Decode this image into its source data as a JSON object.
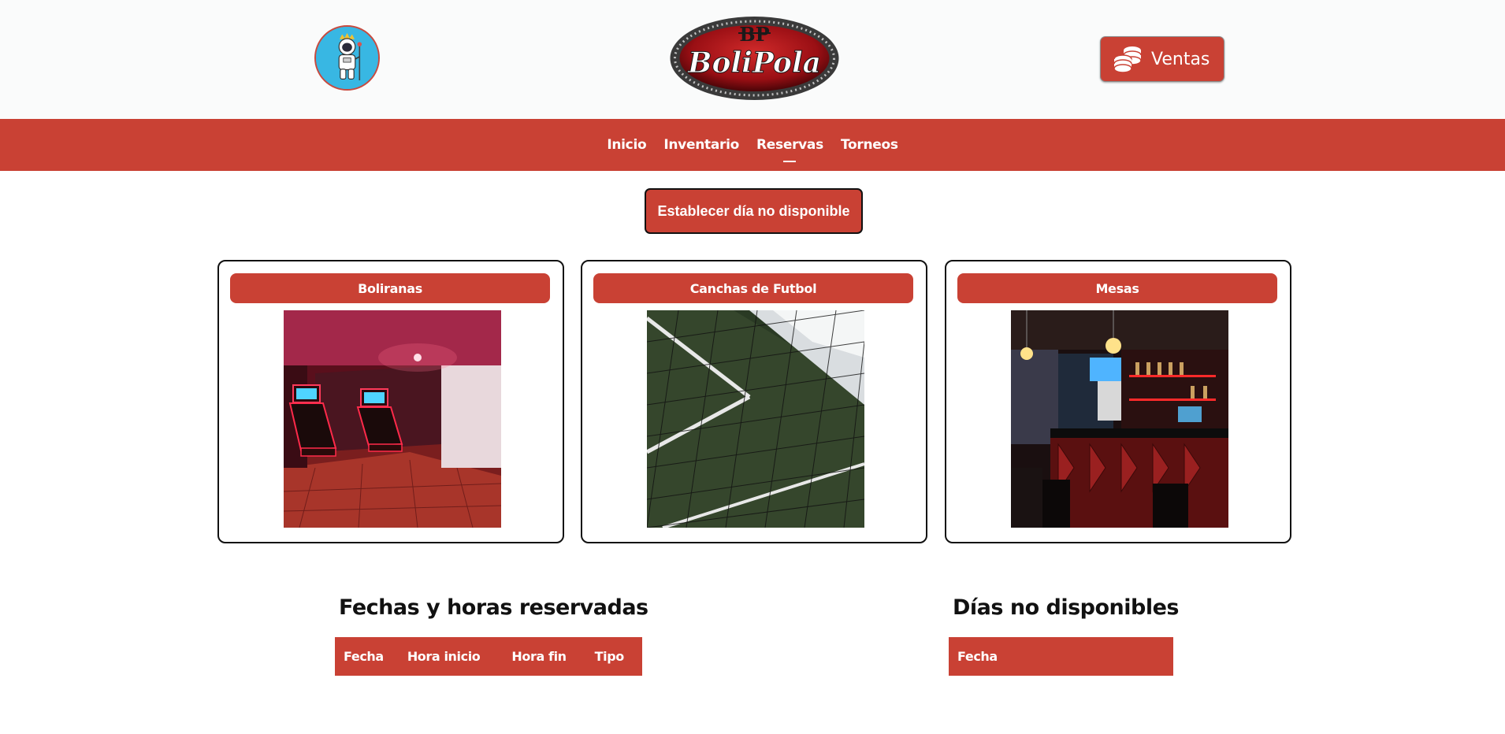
{
  "header": {
    "ventas_label": "Ventas",
    "logo": {
      "monogram": "BP",
      "text": "BoliPola"
    },
    "icons": {
      "avatar": "astronaut-avatar",
      "ventas": "coins-icon"
    }
  },
  "nav": {
    "items": [
      {
        "label": "Inicio"
      },
      {
        "label": "Inventario"
      },
      {
        "label": "Reservas",
        "active": true
      },
      {
        "label": "Torneos"
      }
    ]
  },
  "main": {
    "establish_button": "Establecer día no disponible",
    "cards": [
      {
        "title": "Boliranas"
      },
      {
        "title": "Canchas de Futbol"
      },
      {
        "title": "Mesas"
      }
    ]
  },
  "reservations": {
    "title": "Fechas y horas reservadas",
    "columns": [
      "Fecha",
      "Hora inicio",
      "Hora fin",
      "Tipo"
    ]
  },
  "unavailable": {
    "title": "Días no disponibles",
    "columns": [
      "Fecha"
    ]
  },
  "colors": {
    "accent": "#c94134",
    "header_bg": "#fafbfb",
    "text": "#111111"
  }
}
